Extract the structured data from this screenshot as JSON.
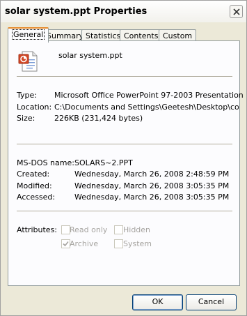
{
  "window": {
    "title": "solar system.ppt Properties"
  },
  "tabs": [
    {
      "label": "General",
      "active": true
    },
    {
      "label": "Summary",
      "active": false
    },
    {
      "label": "Statistics",
      "active": false
    },
    {
      "label": "Contents",
      "active": false
    },
    {
      "label": "Custom",
      "active": false
    }
  ],
  "file": {
    "name": "solar system.ppt",
    "icon": "powerpoint-file-icon"
  },
  "info": {
    "type_label": "Type:",
    "type_value": "Microsoft Office PowerPoint 97-2003 Presentation",
    "location_label": "Location:",
    "location_value": "C:\\Documents and Settings\\Geetesh\\Desktop\\compre",
    "size_label": "Size:",
    "size_value": "226KB (231,424 bytes)"
  },
  "dates": {
    "msdos_label": "MS-DOS name:",
    "msdos_value": "SOLARS~2.PPT",
    "created_label": "Created:",
    "created_value": "Wednesday, March 26, 2008 2:48:59 PM",
    "modified_label": "Modified:",
    "modified_value": "Wednesday, March 26, 2008 3:05:35 PM",
    "accessed_label": "Accessed:",
    "accessed_value": "Wednesday, March 26, 2008 3:05:35 PM"
  },
  "attributes": {
    "label": "Attributes:",
    "read_only": {
      "label": "Read only",
      "checked": false
    },
    "hidden": {
      "label": "Hidden",
      "checked": false
    },
    "archive": {
      "label": "Archive",
      "checked": true
    },
    "system": {
      "label": "System",
      "checked": false
    }
  },
  "buttons": {
    "ok": "OK",
    "cancel": "Cancel"
  },
  "colors": {
    "window_bg": "#ece9d8",
    "panel_bg": "#fcfcfe",
    "active_tab_accent": "#e68b2c",
    "disabled_text": "#a6a4a0"
  }
}
